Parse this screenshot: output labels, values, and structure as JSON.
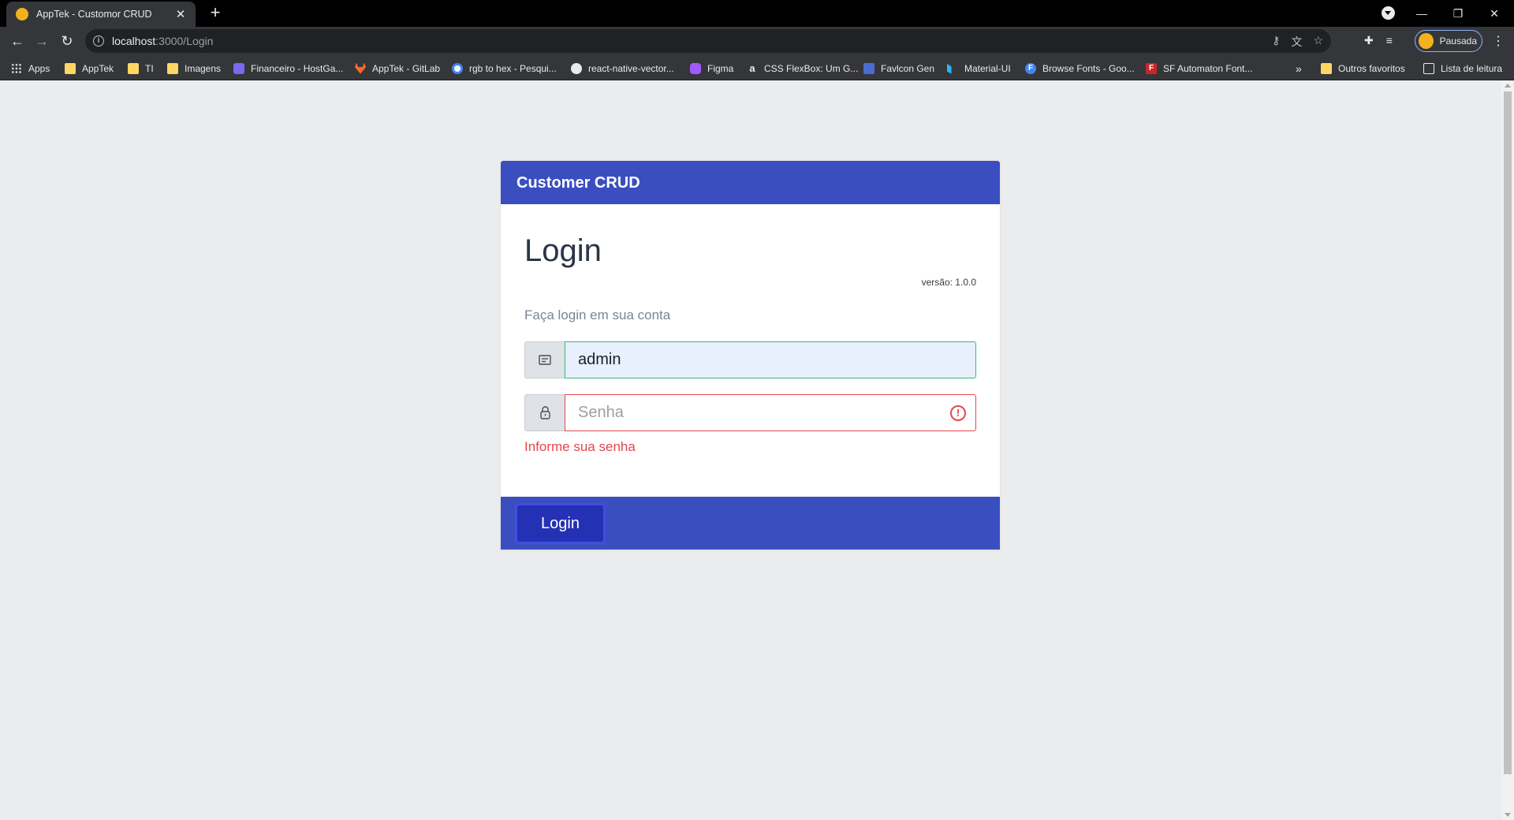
{
  "browser": {
    "tab_title": "AppTek - Customor CRUD",
    "tab_close": "✕",
    "new_tab": "+",
    "window_controls": {
      "minimize": "—",
      "restore": "❐",
      "close": "✕"
    },
    "nav": {
      "back": "←",
      "forward": "→",
      "reload": "↻"
    },
    "url_host": "localhost",
    "url_path": ":3000/Login",
    "profile_status": "Pausada",
    "menu": "⋮",
    "bookmarks": [
      {
        "label": "Apps",
        "icon": "apps-icon"
      },
      {
        "label": "AppTek",
        "icon": "folder-icon"
      },
      {
        "label": "TI",
        "icon": "folder-icon"
      },
      {
        "label": "Imagens",
        "icon": "folder-icon"
      },
      {
        "label": "Financeiro - HostGa...",
        "icon": "hostgator-icon"
      },
      {
        "label": "AppTek - GitLab",
        "icon": "gitlab-icon"
      },
      {
        "label": "rgb to hex - Pesqui...",
        "icon": "google-icon"
      },
      {
        "label": "react-native-vector...",
        "icon": "globe-icon"
      },
      {
        "label": "Figma",
        "icon": "figma-icon"
      },
      {
        "label": "CSS FlexBox: Um G...",
        "icon": "amazon-icon"
      },
      {
        "label": "Favlcon Gen",
        "icon": "favicon-gen-icon"
      },
      {
        "label": "Material-UI",
        "icon": "material-ui-icon"
      },
      {
        "label": "Browse Fonts - Goo...",
        "icon": "google-fonts-icon"
      },
      {
        "label": "SF Automaton Font...",
        "icon": "sf-automaton-icon"
      }
    ],
    "bookmarks_overflow": "»",
    "other_bookmarks": "Outros favoritos",
    "reading_list": "Lista de leitura"
  },
  "page": {
    "card_header": "Customer CRUD",
    "title": "Login",
    "version": "versão: 1.0.0",
    "subtitle": "Faça login em sua conta",
    "username_value": "admin",
    "password_placeholder": "Senha",
    "password_error": "Informe sua senha",
    "submit_label": "Login",
    "error_icon": "!"
  },
  "colors": {
    "header": "#3b4ec0",
    "button": "#2431b4",
    "error": "#e5464f",
    "valid": "#3cb878"
  }
}
